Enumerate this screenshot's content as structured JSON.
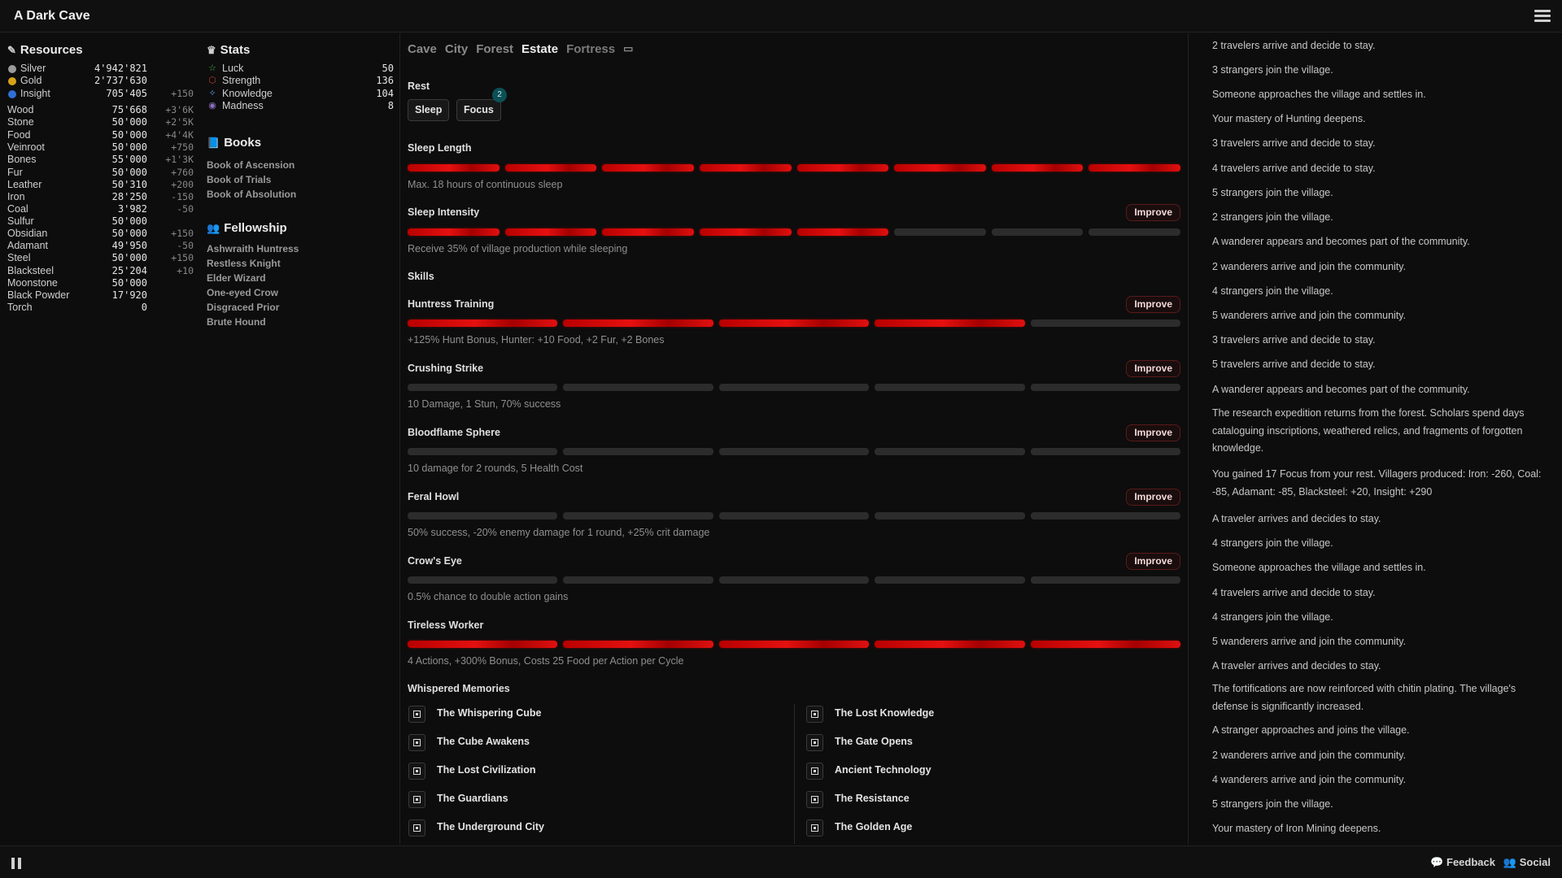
{
  "app": {
    "title": "A Dark Cave"
  },
  "resources": {
    "title": "Resources",
    "items": [
      {
        "name": "Silver",
        "value": "4'942'821",
        "rate": "",
        "dot": "#9a9a9a"
      },
      {
        "name": "Gold",
        "value": "2'737'630",
        "rate": "",
        "dot": "#d9a21a"
      },
      {
        "name": "Insight",
        "value": "705'405",
        "rate": "+150",
        "dot": "#2f6fd6"
      },
      {
        "name": "Wood",
        "value": "75'668",
        "rate": "+3'6K"
      },
      {
        "name": "Stone",
        "value": "50'000",
        "rate": "+2'5K"
      },
      {
        "name": "Food",
        "value": "50'000",
        "rate": "+4'4K"
      },
      {
        "name": "Veinroot",
        "value": "50'000",
        "rate": "+750"
      },
      {
        "name": "Bones",
        "value": "55'000",
        "rate": "+1'3K"
      },
      {
        "name": "Fur",
        "value": "50'000",
        "rate": "+760"
      },
      {
        "name": "Leather",
        "value": "50'310",
        "rate": "+200"
      },
      {
        "name": "Iron",
        "value": "28'250",
        "rate": "-150"
      },
      {
        "name": "Coal",
        "value": "3'982",
        "rate": "-50"
      },
      {
        "name": "Sulfur",
        "value": "50'000",
        "rate": ""
      },
      {
        "name": "Obsidian",
        "value": "50'000",
        "rate": "+150"
      },
      {
        "name": "Adamant",
        "value": "49'950",
        "rate": "-50"
      },
      {
        "name": "Steel",
        "value": "50'000",
        "rate": "+150"
      },
      {
        "name": "Blacksteel",
        "value": "25'204",
        "rate": "+10"
      },
      {
        "name": "Moonstone",
        "value": "50'000",
        "rate": ""
      },
      {
        "name": "Black Powder",
        "value": "17'920",
        "rate": ""
      },
      {
        "name": "Torch",
        "value": "0",
        "rate": ""
      }
    ]
  },
  "stats": {
    "title": "Stats",
    "items": [
      {
        "name": "Luck",
        "value": "50",
        "icon": "☆",
        "icon_color": "#4caf50"
      },
      {
        "name": "Strength",
        "value": "136",
        "icon": "⬡",
        "icon_color": "#c0392b"
      },
      {
        "name": "Knowledge",
        "value": "104",
        "icon": "✧",
        "icon_color": "#5b8fd6"
      },
      {
        "name": "Madness",
        "value": "8",
        "icon": "◉",
        "icon_color": "#8e6fc4"
      }
    ]
  },
  "books": {
    "title": "Books",
    "items": [
      "Book of Ascension",
      "Book of Trials",
      "Book of Absolution"
    ]
  },
  "fellowship": {
    "title": "Fellowship",
    "items": [
      "Ashwraith Huntress",
      "Restless Knight",
      "Elder Wizard",
      "One-eyed Crow",
      "Disgraced Prior",
      "Brute Hound"
    ]
  },
  "tabs": [
    {
      "label": "Cave",
      "active": false
    },
    {
      "label": "City",
      "active": false
    },
    {
      "label": "Forest",
      "active": false
    },
    {
      "label": "Estate",
      "active": true
    },
    {
      "label": "Fortress",
      "active": false
    }
  ],
  "rest": {
    "title": "Rest",
    "sleep_label": "Sleep",
    "focus_label": "Focus",
    "focus_badge": "2",
    "sleep_length": {
      "title": "Sleep Length",
      "level": 8,
      "max": 8,
      "desc": "Max. 18 hours of continuous sleep"
    },
    "sleep_intensity": {
      "title": "Sleep Intensity",
      "level": 5,
      "max": 8,
      "desc": "Receive 35% of village production while sleeping",
      "button": "Improve"
    }
  },
  "skills": {
    "title": "Skills",
    "items": [
      {
        "name": "Huntress Training",
        "level": 4,
        "max": 5,
        "desc": "+125% Hunt Bonus, Hunter: +10 Food, +2 Fur, +2 Bones",
        "button": "Improve"
      },
      {
        "name": "Crushing Strike",
        "level": 0,
        "max": 5,
        "desc": "10 Damage, 1 Stun, 70% success",
        "button": "Improve"
      },
      {
        "name": "Bloodflame Sphere",
        "level": 0,
        "max": 5,
        "desc": "10 damage for 2 rounds, 5 Health Cost",
        "button": "Improve"
      },
      {
        "name": "Feral Howl",
        "level": 0,
        "max": 5,
        "desc": "50% success, -20% enemy damage for 1 round, +25% crit damage",
        "button": "Improve"
      },
      {
        "name": "Crow's Eye",
        "level": 0,
        "max": 5,
        "desc": "0.5% chance to double action gains",
        "button": "Improve"
      },
      {
        "name": "Tireless Worker",
        "level": 5,
        "max": 5,
        "desc": "4 Actions, +300% Bonus, Costs 25 Food per Action per Cycle",
        "button": ""
      }
    ]
  },
  "memories": {
    "title": "Whispered Memories",
    "left": [
      "The Whispering Cube",
      "The Cube Awakens",
      "The Lost Civilization",
      "The Guardians",
      "The Underground City"
    ],
    "right": [
      "The Lost Knowledge",
      "The Gate Opens",
      "Ancient Technology",
      "The Resistance",
      "The Golden Age"
    ]
  },
  "log": [
    "2 travelers arrive and decide to stay.",
    "3 strangers join the village.",
    "Someone approaches the village and settles in.",
    "Your mastery of Hunting deepens.",
    "3 travelers arrive and decide to stay.",
    "4 travelers arrive and decide to stay.",
    "5 strangers join the village.",
    "2 strangers join the village.",
    "A wanderer appears and becomes part of the community.",
    "2 wanderers arrive and join the community.",
    "4 strangers join the village.",
    "5 wanderers arrive and join the community.",
    "3 travelers arrive and decide to stay.",
    "5 travelers arrive and decide to stay.",
    "A wanderer appears and becomes part of the community.",
    "The research expedition returns from the forest. Scholars spend days cataloguing inscriptions, weathered relics, and fragments of forgotten knowledge.",
    "You gained 17 Focus from your rest. Villagers produced: Iron: -260, Coal: -85, Adamant: -85, Blacksteel: +20, Insight: +290",
    "A traveler arrives and decides to stay.",
    "4 strangers join the village.",
    "Someone approaches the village and settles in.",
    "4 travelers arrive and decide to stay.",
    "4 strangers join the village.",
    "5 wanderers arrive and join the community.",
    "A traveler arrives and decides to stay.",
    "The fortifications are now reinforced with chitin plating. The village's defense is significantly increased.",
    "A stranger approaches and joins the village.",
    "2 wanderers arrive and join the community.",
    "4 wanderers arrive and join the community.",
    "5 strangers join the village.",
    "Your mastery of Iron Mining deepens."
  ],
  "footer": {
    "feedback": "Feedback",
    "social": "Social"
  }
}
